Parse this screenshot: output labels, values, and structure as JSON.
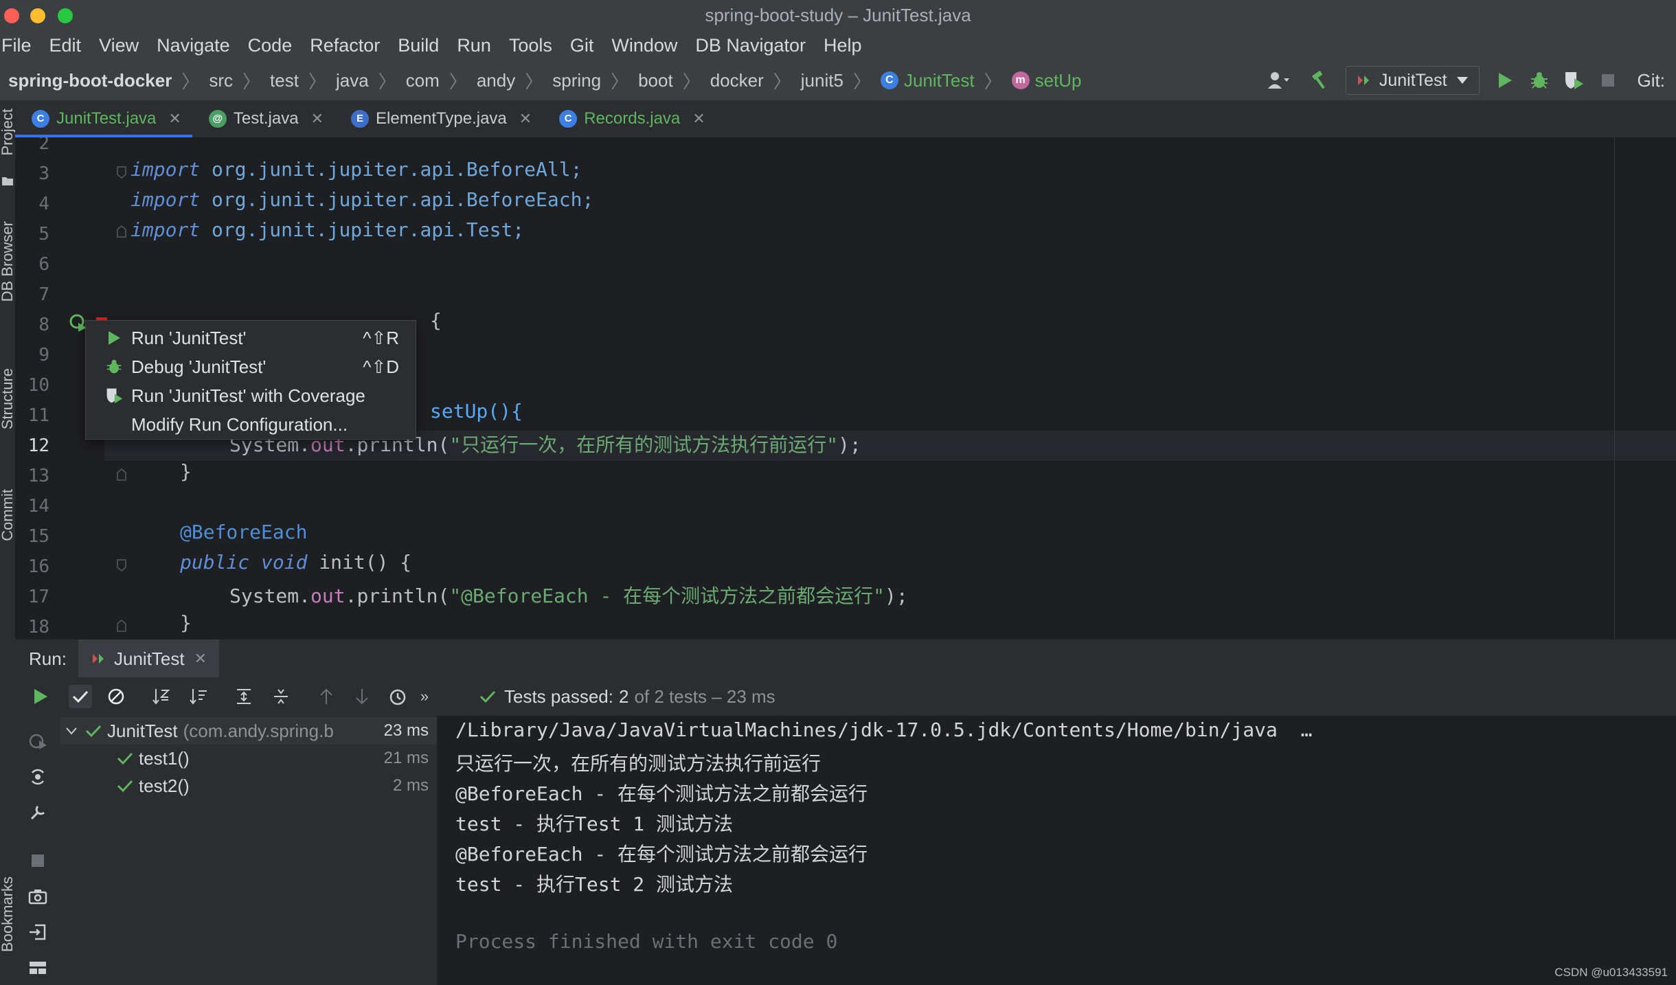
{
  "window": {
    "title": "spring-boot-study – JunitTest.java",
    "traffic_lights": [
      "#ff5f57",
      "#febc2e",
      "#28c840"
    ]
  },
  "menu": [
    "File",
    "Edit",
    "View",
    "Navigate",
    "Code",
    "Refactor",
    "Build",
    "Run",
    "Tools",
    "Git",
    "Window",
    "DB Navigator",
    "Help"
  ],
  "breadcrumb": {
    "items": [
      "spring-boot-docker",
      "src",
      "test",
      "java",
      "com",
      "andy",
      "spring",
      "boot",
      "docker",
      "junit5"
    ],
    "class_name": "JunitTest",
    "method_name": "setUp"
  },
  "toolbar": {
    "run_config": "JunitTest",
    "git_label": "Git:"
  },
  "tool_stripe": [
    "Project",
    "DB Browser",
    "Structure",
    "Commit",
    "Bookmarks"
  ],
  "tabs": [
    {
      "label": "JunitTest.java",
      "icon": "class-test-icon",
      "active": true
    },
    {
      "label": "Test.java",
      "icon": "annotation-icon",
      "active": false
    },
    {
      "label": "ElementType.java",
      "icon": "enum-icon",
      "active": false
    },
    {
      "label": "Records.java",
      "icon": "record-icon",
      "active": false
    }
  ],
  "editor": {
    "line_numbers": [
      "2",
      "3",
      "4",
      "5",
      "6",
      "7",
      "8",
      "9",
      "10",
      "11",
      "12",
      "13",
      "14",
      "15",
      "16",
      "17",
      "18"
    ],
    "current_line": "12",
    "lines": {
      "l3": {
        "kw": "import",
        "rest": " org.junit.jupiter.api.BeforeAll;"
      },
      "l4": {
        "kw": "import",
        "rest": " org.junit.jupiter.api.BeforeEach;"
      },
      "l5": {
        "kw": "import",
        "rest": " org.junit.jupiter.api.Test;"
      },
      "l8_tail": "{",
      "l11_tail": "setUp(){",
      "l12": {
        "recv": "System.",
        "field": "out",
        "call": ".println(",
        "str": "\"只运行一次，在所有的测试方法执行前运行\"",
        "end": ");"
      },
      "l13": "}",
      "l15": "@BeforeEach",
      "l16": {
        "kw": "public void",
        "rest": " init() {"
      },
      "l17": {
        "recv": "System.",
        "field": "out",
        "call": ".println(",
        "str": "\"@BeforeEach - 在每个测试方法之前都会运行\"",
        "end": ");"
      },
      "l18": "}"
    }
  },
  "popup": {
    "items": [
      {
        "label": "Run 'JunitTest'",
        "shortcut": "^⇧R",
        "icon": "run-icon"
      },
      {
        "label": "Debug 'JunitTest'",
        "shortcut": "^⇧D",
        "icon": "debug-icon"
      },
      {
        "label": "Run 'JunitTest' with Coverage",
        "shortcut": "",
        "icon": "coverage-icon"
      },
      {
        "label": "Modify Run Configuration...",
        "shortcut": "",
        "icon": ""
      }
    ]
  },
  "run_panel": {
    "label": "Run:",
    "tab_label": "JunitTest",
    "status": {
      "prefix": "Tests passed:",
      "passed": "2",
      "rest": "of 2 tests – 23 ms"
    },
    "tree": [
      {
        "name": "JunitTest",
        "detail": "(com.andy.spring.b",
        "duration": "23 ms"
      },
      {
        "name": "test1()",
        "duration": "21 ms"
      },
      {
        "name": "test2()",
        "duration": "2 ms"
      }
    ],
    "console": [
      "/Library/Java/JavaVirtualMachines/jdk-17.0.5.jdk/Contents/Home/bin/java  …",
      "只运行一次，在所有的测试方法执行前运行",
      "@BeforeEach - 在每个测试方法之前都会运行",
      "test - 执行Test 1 测试方法",
      "@BeforeEach - 在每个测试方法之前都会运行",
      "test - 执行Test 2 测试方法",
      "",
      "Process finished with exit code 0"
    ]
  },
  "watermark": "CSDN @u013433591",
  "colors": {
    "accent": "#3574f0",
    "success": "#5fb65f",
    "string": "#6aab73",
    "keyword": "#5f8fd6"
  }
}
